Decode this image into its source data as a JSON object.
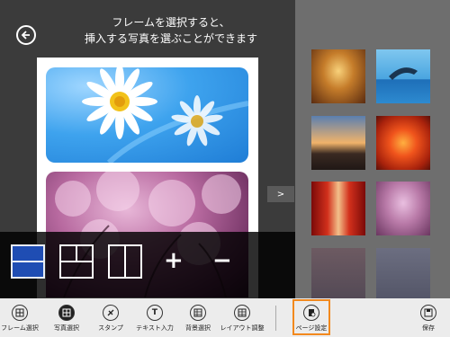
{
  "instruction": {
    "line1": "フレームを選択すると、",
    "line2": "挿入する写真を選ぶことができます"
  },
  "next_button": ">",
  "frame_bar": {
    "plus": "+",
    "minus": "−"
  },
  "appbar": {
    "frame_select": "フレーム選択",
    "photo_select": "写真選択",
    "stamp": "スタンプ",
    "text_input": "テキスト入力",
    "background_select": "背景選択",
    "layout_adjust": "レイアウト調整",
    "page_settings": "ページ設定",
    "save": "保存"
  },
  "colors": {
    "accent_highlight": "#f2891e",
    "selected_frame": "#1f4db3"
  }
}
